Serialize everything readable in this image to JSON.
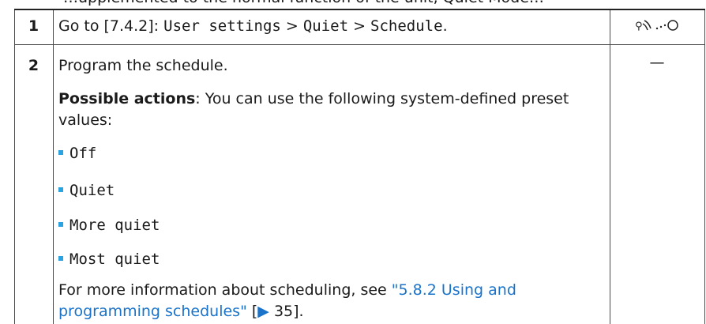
{
  "partial_text": "…upplemented to the normal function of the unit, Quiet Mode…",
  "rows": [
    {
      "number": "1",
      "goto_prefix": "Go to [7.4.2]: ",
      "path_1": "User settings",
      "sep_1": " > ",
      "path_2": "Quiet",
      "sep_2": " > ",
      "path_3": "Schedule",
      "end": ".",
      "icon_text": "⌘···○"
    },
    {
      "number": "2",
      "instruction": "Program the schedule.",
      "possible_label": "Possible actions",
      "possible_text": ": You can use the following system-defined preset values:",
      "values": [
        "Off",
        "Quiet",
        "More quiet",
        "Most quiet"
      ],
      "more_info_prefix": "For more information about scheduling, see ",
      "link_text": "\"5.8.2 Using and programming schedules\"",
      "ref_text": " [",
      "ref_arrow": "▶",
      "ref_page": " 35].",
      "dash": "—"
    }
  ]
}
